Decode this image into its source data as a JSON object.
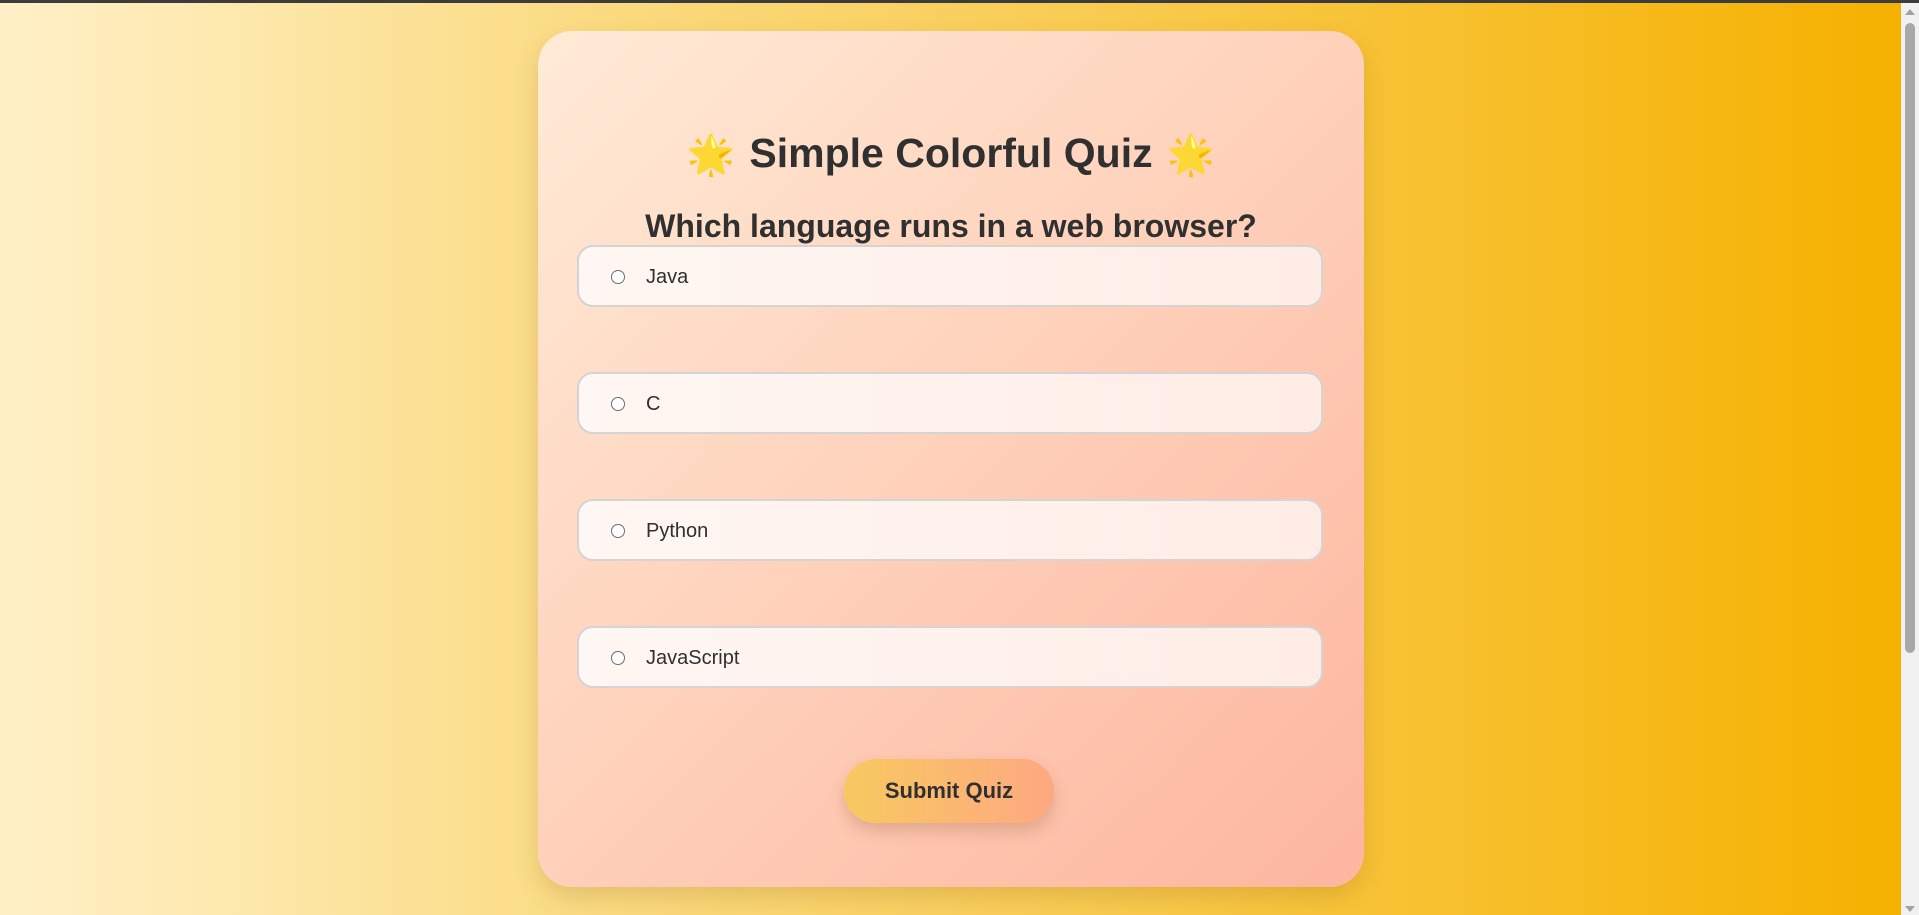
{
  "quiz": {
    "title": "Simple Colorful Quiz",
    "title_emoji_left": "🌟",
    "title_emoji_right": "🌟",
    "question": "Which language runs in a web browser?",
    "options": [
      {
        "label": "Java",
        "selected": false
      },
      {
        "label": "C",
        "selected": false
      },
      {
        "label": "Python",
        "selected": false
      },
      {
        "label": "JavaScript",
        "selected": false
      }
    ],
    "submit_label": "Submit Quiz"
  },
  "colors": {
    "background_gradient": [
      "#fff0c8",
      "#f6b100"
    ],
    "card_gradient": [
      "#ffebd7",
      "#fdb59e"
    ],
    "text": "#303030",
    "button_gradient": [
      "#f8c95f",
      "#fda882"
    ]
  }
}
